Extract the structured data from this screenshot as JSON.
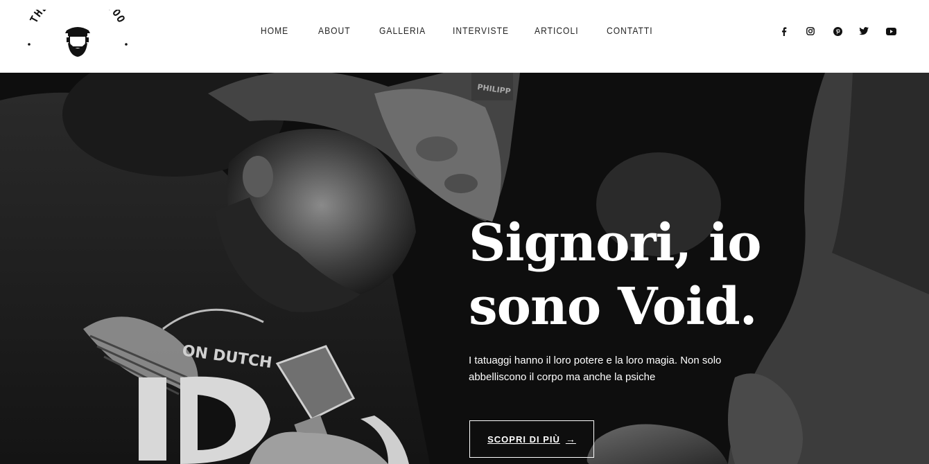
{
  "brand": {
    "logo_text": "THE VOID TATTOO"
  },
  "nav": {
    "items": [
      {
        "label": "HOME"
      },
      {
        "label": "ABOUT"
      },
      {
        "label": "GALLERIA"
      },
      {
        "label": "INTERVISTE"
      },
      {
        "label": "ARTICOLI"
      },
      {
        "label": "CONTATTI"
      }
    ]
  },
  "social": {
    "icons": [
      "facebook-icon",
      "instagram-icon",
      "pinterest-icon",
      "twitter-icon",
      "youtube-icon"
    ]
  },
  "hero": {
    "title_line1": "Signori, io",
    "title_line2": "sono Void.",
    "text": "I tatuaggi hanno il loro potere e la loro magia. Non solo abbelliscono il corpo ma anche la psiche",
    "cta_label": "SCOPRI DI PIÙ",
    "photo_text_shirt": "ON DUTCH",
    "photo_text_cap": "PHILIPP"
  },
  "colors": {
    "header_bg": "#ffffff",
    "hero_bg": "#111111",
    "text_dark": "#222222",
    "text_light": "#ffffff"
  }
}
